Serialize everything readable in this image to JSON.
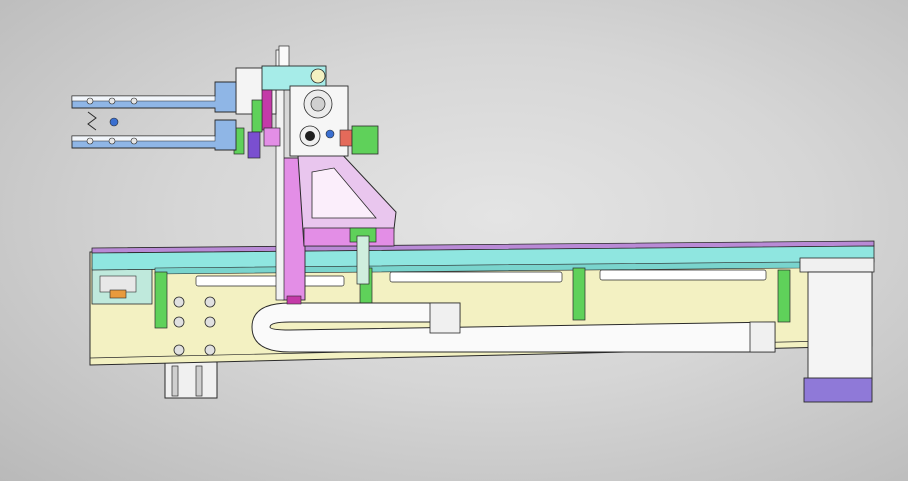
{
  "viewport": {
    "background_top": "#e4e4e4",
    "background_bottom": "#b9b9b9"
  },
  "colors": {
    "base_yellow": "#f3f1c2",
    "rail_cyan": "#8fe6e0",
    "rail_purple": "#b98ad6",
    "plate_magenta": "#e38ee6",
    "bracket_green": "#5fd15a",
    "arm_blue": "#8fb6e6",
    "motor_purple": "#8f79d8",
    "chain_white": "#fafafa",
    "outline": "#2a2a2a"
  },
  "model": {
    "components": [
      "base-frame",
      "linear-rail",
      "cable-chain",
      "drive-motor",
      "vertical-column",
      "triangular-bracket",
      "gripper-head",
      "gripper-fingers",
      "support-feet"
    ]
  }
}
